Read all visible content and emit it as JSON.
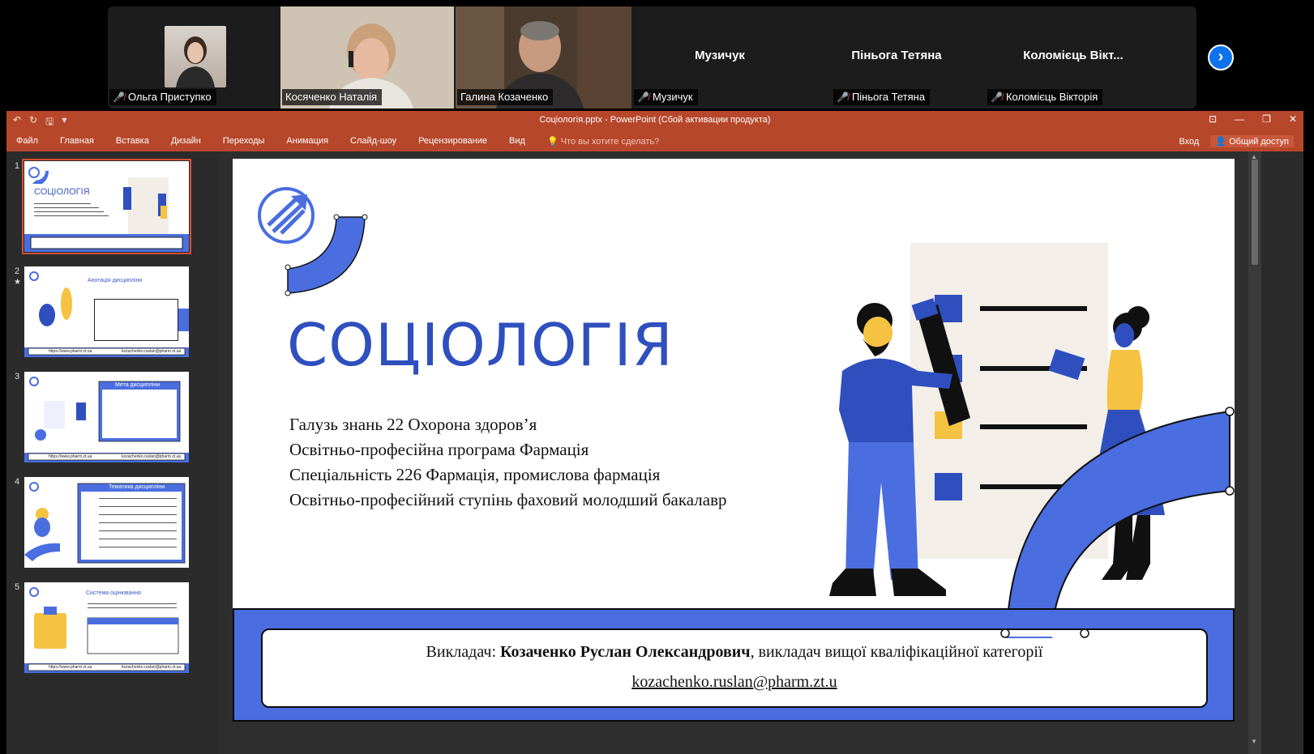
{
  "zoom": {
    "participants": [
      {
        "name": "Ольга Приступко",
        "video": true,
        "muted": true
      },
      {
        "name": "Косяченко Наталія",
        "video": true,
        "muted": false
      },
      {
        "name": "Галина Козаченко",
        "video": true,
        "muted": false,
        "active": true
      },
      {
        "name": "Музичук",
        "video": false,
        "muted": true
      },
      {
        "name": "Піньога Тетяна",
        "video": false,
        "muted": true
      },
      {
        "name": "Коломієць Вікторія",
        "display_name": "Коломієць Вікт...",
        "video": false,
        "muted": true
      }
    ],
    "next_icon": "chevron-right-icon",
    "accent": "#0e72ed",
    "active_border": "#2ee08a"
  },
  "powerpoint": {
    "window_title": "Соціологія.pptx - PowerPoint (Сбой активации продукта)",
    "tabs": [
      "Файл",
      "Главная",
      "Вставка",
      "Дизайн",
      "Переходы",
      "Анимация",
      "Слайд-шоу",
      "Рецензирование",
      "Вид"
    ],
    "tell_me": "Что вы хотите сделать?",
    "sign_in": "Вход",
    "share": "Общий доступ",
    "accent": "#b7472a",
    "thumbnails": [
      {
        "num": "1",
        "title": "СОЦІОЛОГІЯ",
        "selected": true
      },
      {
        "num": "2",
        "title": "Анотація дисципліни",
        "star": "★"
      },
      {
        "num": "3",
        "title": "Мета дисципліни"
      },
      {
        "num": "4",
        "title": "Тематика дисципліни"
      },
      {
        "num": "5",
        "title": "Система оцінювання"
      }
    ],
    "thumb_footer_left": "https://www.pharm.zt.ua",
    "thumb_footer_right": "kozachenko.ruslan@pharm.zt.ua"
  },
  "slide": {
    "title": "СОЦІОЛОГІЯ",
    "lines": [
      "Галузь знань 22 Охорона здоров’я",
      "Освітньо-професійна програма Фармація",
      "Спеціальність 226 Фармація, промислова фармація",
      "Освітньо-професійний ступінь фаховий молодший бакалавр"
    ],
    "teacher_prefix": "Викладач: ",
    "teacher_name": "Козаченко Руслан Олександрович",
    "teacher_suffix": ", викладач вищої кваліфікаційної категорії",
    "email": "kozachenko.ruslan@pharm.zt.u",
    "brand_color": "#4a6ee0",
    "title_color": "#2f4fbf",
    "yellow": "#f5c242"
  }
}
